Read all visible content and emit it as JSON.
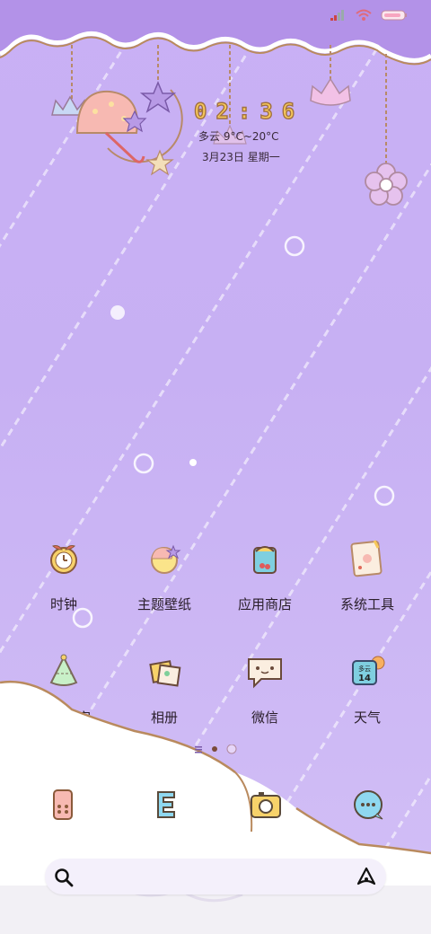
{
  "status": {
    "signal_icon": "signal-icon",
    "wifi_icon": "wifi-icon",
    "battery_icon": "battery-icon"
  },
  "clock": {
    "time": "02:36",
    "weather": "多云 9°C~20°C",
    "date": "3月23日 星期一"
  },
  "apps": [
    {
      "label": "时钟",
      "icon": "alarm-clock-icon"
    },
    {
      "label": "主题壁纸",
      "icon": "theme-wallpaper-icon"
    },
    {
      "label": "应用商店",
      "icon": "app-store-icon"
    },
    {
      "label": "系统工具",
      "icon": "system-tools-icon"
    },
    {
      "label": "手机管家",
      "icon": "phone-manager-icon"
    },
    {
      "label": "相册",
      "icon": "gallery-icon"
    },
    {
      "label": "微信",
      "icon": "wechat-icon"
    },
    {
      "label": "天气",
      "icon": "weather-icon"
    }
  ],
  "weather_icon_text": {
    "line1": "多云",
    "line2": "14"
  },
  "dock": [
    {
      "icon": "phone-icon"
    },
    {
      "icon": "browser-icon"
    },
    {
      "icon": "camera-icon"
    },
    {
      "icon": "messages-icon"
    }
  ],
  "search": {
    "icon": "search-icon",
    "right_icon": "assistant-icon"
  },
  "colors": {
    "background": "#c9b0f5",
    "cloud": "#ffffff",
    "cloud_outline": "#b98a5e",
    "accent_yellow": "#f7c85a"
  }
}
